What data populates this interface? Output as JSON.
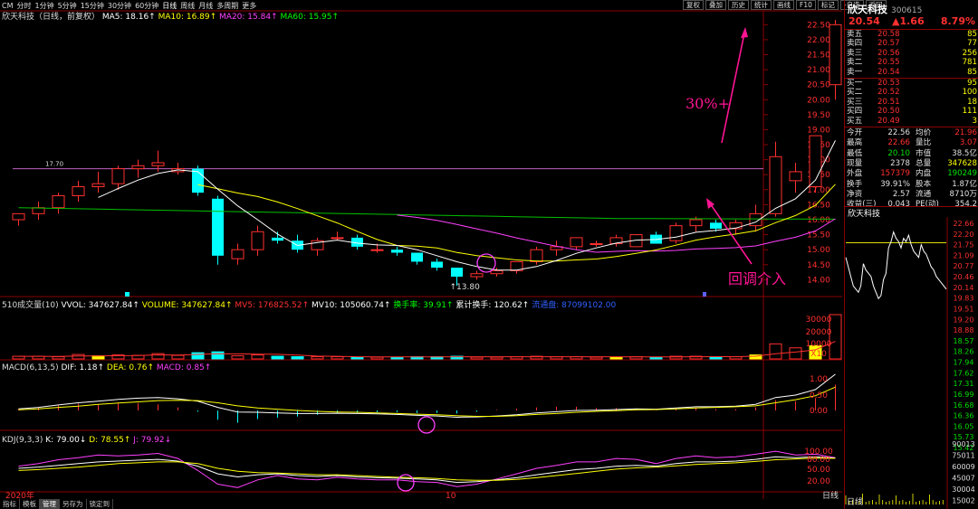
{
  "toolbar": {
    "items": [
      "CM",
      "分时",
      "1分钟",
      "5分钟",
      "15分钟",
      "30分钟",
      "60分钟",
      "日线",
      "周线",
      "月线",
      "多周期",
      "更多"
    ],
    "selected": "日线",
    "right_buttons": [
      "复权",
      "叠加",
      "历史",
      "统计",
      "画线",
      "F10",
      "标记",
      "-自选",
      "返回"
    ]
  },
  "price_header": {
    "title": "欣天科技（日线，前复权）",
    "ma5": "MA5: 18.16↑",
    "ma10": "MA10: 16.89↑",
    "ma20": "MA20: 15.84↑",
    "ma60": "MA60: 15.95↑"
  },
  "chart_data": {
    "type": "candlestick",
    "candles": [
      [
        16.0,
        16.2,
        15.8,
        16.2
      ],
      [
        16.2,
        16.6,
        16.0,
        16.4
      ],
      [
        16.4,
        16.9,
        16.2,
        16.8
      ],
      [
        16.8,
        17.3,
        16.6,
        17.1
      ],
      [
        17.1,
        17.6,
        16.9,
        17.2
      ],
      [
        17.2,
        17.8,
        17.0,
        17.7
      ],
      [
        17.7,
        18.0,
        17.4,
        17.8
      ],
      [
        17.8,
        18.3,
        17.6,
        17.9
      ],
      [
        17.6,
        17.9,
        17.5,
        17.7
      ],
      [
        17.7,
        17.8,
        16.8,
        16.9
      ],
      [
        16.7,
        16.8,
        14.5,
        14.8
      ],
      [
        14.7,
        15.2,
        14.5,
        15.0
      ],
      [
        15.0,
        15.8,
        14.8,
        15.6
      ],
      [
        15.4,
        15.6,
        15.2,
        15.3
      ],
      [
        15.3,
        15.5,
        14.9,
        15.0
      ],
      [
        15.0,
        15.4,
        14.8,
        15.3
      ],
      [
        15.4,
        15.6,
        15.3,
        15.4
      ],
      [
        15.4,
        15.5,
        15.0,
        15.1
      ],
      [
        15.0,
        15.2,
        14.9,
        15.0
      ],
      [
        15.0,
        15.1,
        14.8,
        14.9
      ],
      [
        14.9,
        14.9,
        14.5,
        14.6
      ],
      [
        14.6,
        14.7,
        14.3,
        14.4
      ],
      [
        14.4,
        14.4,
        13.8,
        14.1
      ],
      [
        14.1,
        14.3,
        14.0,
        14.2
      ],
      [
        14.2,
        14.4,
        14.1,
        14.3
      ],
      [
        14.3,
        14.6,
        14.2,
        14.6
      ],
      [
        14.6,
        15.1,
        14.5,
        15.0
      ],
      [
        15.0,
        15.3,
        14.8,
        15.1
      ],
      [
        15.1,
        15.4,
        15.0,
        15.4
      ],
      [
        15.2,
        15.3,
        15.1,
        15.2
      ],
      [
        15.2,
        15.5,
        15.1,
        15.4
      ],
      [
        15.1,
        15.5,
        15.1,
        15.5
      ],
      [
        15.5,
        15.6,
        15.2,
        15.2
      ],
      [
        15.3,
        15.9,
        15.2,
        15.8
      ],
      [
        15.8,
        16.1,
        15.6,
        16.0
      ],
      [
        15.9,
        16.0,
        15.6,
        15.7
      ],
      [
        15.7,
        16.0,
        15.5,
        15.9
      ],
      [
        15.8,
        16.5,
        15.6,
        16.2
      ],
      [
        16.2,
        18.6,
        16.1,
        18.1
      ],
      [
        17.3,
        17.9,
        16.9,
        17.6
      ],
      [
        17.1,
        18.8,
        16.9,
        18.8
      ],
      [
        20.5,
        22.66,
        20.0,
        22.5
      ]
    ],
    "ylim": [
      13.8,
      22.66
    ],
    "price_labels": [
      "22.50",
      "22.00",
      "21.50",
      "21.00",
      "20.50",
      "20.00",
      "19.50",
      "19.00",
      "18.50",
      "18.00",
      "17.50",
      "17.00",
      "16.50",
      "16.00",
      "15.50",
      "15.00",
      "14.50",
      "14.00"
    ],
    "high_label": "22.66",
    "low_label": "13.80",
    "level_label": "17.70",
    "annotations": [
      "30%+",
      "回调介入"
    ]
  },
  "volume": {
    "title": "510成交量(10)",
    "vvol": "VVOL: 347627.84↑",
    "volume": "VOLUME: 347627.84↑",
    "mv5": "MV5: 176825.52↑",
    "mv10": "MV10: 105060.74↑",
    "hs": "换手率: 39.91↑",
    "ljhs": "累计换手: 120.62↑",
    "ltzb": "流通盘: 87099102.00",
    "axis": [
      "30000",
      "20000",
      "10000",
      "X10"
    ]
  },
  "macd": {
    "title": "MACD(6,13,5)",
    "dif": "DIF: 1.18↑",
    "dea": "DEA: 0.76↑",
    "macd": "MACD: 0.85↑",
    "axis": [
      "1.00",
      "0.50",
      "0.00"
    ]
  },
  "kdj": {
    "title": "KDJ(9,3,3)",
    "k": "K: 79.00↓",
    "d": "D: 78.55↑",
    "j": "J: 79.92↓",
    "axis": [
      "100.00",
      "80.00",
      "50.00",
      "20.00"
    ]
  },
  "footer": {
    "year": "2020年",
    "month": "10",
    "cycle": "日线",
    "tabs": [
      "指标",
      "模板",
      "管理",
      "另存为",
      "锁定到"
    ],
    "selected_tab": "管理"
  },
  "quote": {
    "name": "欣天科技",
    "code": "300615",
    "price": "20.54",
    "change": "▲1.66",
    "pct": "8.79%",
    "asks": [
      {
        "label": "卖五",
        "price": "20.58",
        "vol": "85"
      },
      {
        "label": "卖四",
        "price": "20.57",
        "vol": "77"
      },
      {
        "label": "卖三",
        "price": "20.56",
        "vol": "256"
      },
      {
        "label": "卖二",
        "price": "20.55",
        "vol": "781"
      },
      {
        "label": "卖一",
        "price": "20.54",
        "vol": "85"
      }
    ],
    "bids": [
      {
        "label": "买一",
        "price": "20.53",
        "vol": "95"
      },
      {
        "label": "买二",
        "price": "20.52",
        "vol": "100"
      },
      {
        "label": "买三",
        "price": "20.51",
        "vol": "18"
      },
      {
        "label": "买四",
        "price": "20.50",
        "vol": "111"
      },
      {
        "label": "买五",
        "price": "20.49",
        "vol": "3"
      }
    ],
    "stats": [
      {
        "k1": "今开",
        "v1": "22.56",
        "k2": "均价",
        "v2": "21.96"
      },
      {
        "k1": "最高",
        "v1": "22.66",
        "k2": "量比",
        "v2": "3.07"
      },
      {
        "k1": "最低",
        "v1": "20.10",
        "k2": "市值",
        "v2": "38.5亿"
      },
      {
        "k1": "现量",
        "v1": "2378",
        "k2": "总量",
        "v2": "347628"
      },
      {
        "k1": "外盘",
        "v1": "157379",
        "k2": "内盘",
        "v2": "190249"
      },
      {
        "k1": "换手",
        "v1": "39.91%",
        "k2": "股本",
        "v2": "1.87亿"
      },
      {
        "k1": "净资",
        "v1": "2.57",
        "k2": "流通",
        "v2": "8710万"
      },
      {
        "k1": "收益(三)",
        "v1": "0.043",
        "k2": "PE(动)",
        "v2": "354.2"
      }
    ],
    "mini_title": "欣天科技",
    "mini_axis": [
      "22.66",
      "22.20",
      "21.75",
      "21.09",
      "20.77",
      "20.46",
      "20.14",
      "19.83",
      "19.51",
      "19.20",
      "18.88",
      "18.57",
      "18.26",
      "17.94",
      "17.62",
      "17.31",
      "16.99",
      "16.68",
      "16.36",
      "16.05",
      "15.73",
      "15.42"
    ],
    "mini_vol_axis": [
      "90013",
      "75011",
      "60009",
      "45007",
      "30004",
      "15002"
    ],
    "mini_cycle": "日线"
  }
}
